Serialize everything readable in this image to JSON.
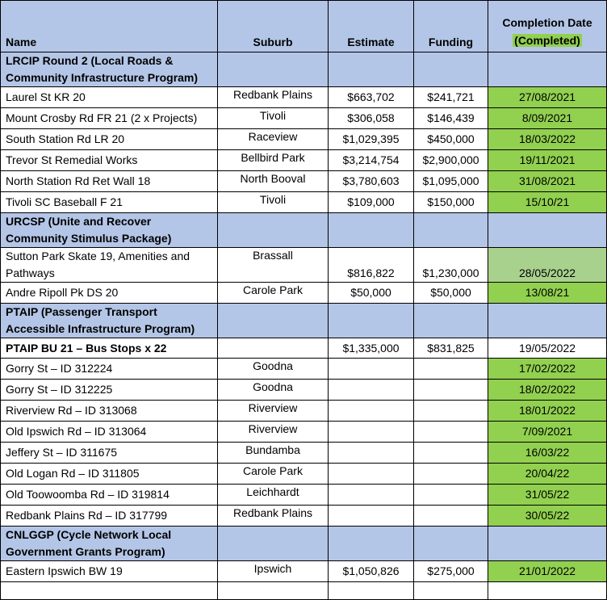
{
  "headers": {
    "name": "Name",
    "suburb": "Suburb",
    "estimate": "Estimate",
    "funding": "Funding",
    "date": "Completion Date",
    "date_sub": "(Completed)"
  },
  "sections": [
    {
      "title": "LRCIP Round 2 (Local Roads & Community Infrastructure Program)",
      "rows": [
        {
          "name": "Laurel St KR 20",
          "suburb": "Redbank Plains",
          "estimate": "$663,702",
          "funding": "$241,721",
          "date": "27/08/2021"
        },
        {
          "name": "Mount Crosby Rd FR 21 (2 x Projects)",
          "suburb": "Tivoli",
          "estimate": "$306,058",
          "funding": "$146,439",
          "date": "8/09/2021"
        },
        {
          "name": "South Station Rd LR 20",
          "suburb": "Raceview",
          "estimate": "$1,029,395",
          "funding": "$450,000",
          "date": "18/03/2022"
        },
        {
          "name": "Trevor St Remedial Works",
          "suburb": "Bellbird Park",
          "estimate": "$3,214,754",
          "funding": "$2,900,000",
          "date": "19/11/2021"
        },
        {
          "name": "North Station Rd Ret Wall 18",
          "suburb": "North Booval",
          "estimate": "$3,780,603",
          "funding": "$1,095,000",
          "date": "31/08/2021"
        },
        {
          "name": "Tivoli SC Baseball F 21",
          "suburb": "Tivoli",
          "estimate": "$109,000",
          "funding": "$150,000",
          "date": "15/10/21"
        }
      ]
    },
    {
      "title": "URCSP (Unite and Recover Community Stimulus Package)",
      "rows": [
        {
          "name": "Sutton Park Skate 19, Amenities and Pathways",
          "suburb": "Brassall",
          "estimate": "$816,822",
          "funding": "$1,230,000",
          "date": "28/05/2022"
        },
        {
          "name": "Andre Ripoll Pk DS 20",
          "suburb": "Carole Park",
          "estimate": "$50,000",
          "funding": "$50,000",
          "date": "13/08/21"
        }
      ]
    },
    {
      "title": "PTAIP (Passenger Transport Accessible Infrastructure Program)",
      "subheader": {
        "name": "PTAIP BU 21 – Bus Stops x 22",
        "estimate": "$1,335,000",
        "funding": "$831,825",
        "date": "19/05/2022"
      },
      "rows": [
        {
          "name": "Gorry St – ID 312224",
          "suburb": "Goodna",
          "date": "17/02/2022"
        },
        {
          "name": "Gorry St – ID 312225",
          "suburb": "Goodna",
          "date": "18/02/2022"
        },
        {
          "name": "Riverview Rd – ID 313068",
          "suburb": "Riverview",
          "date": "18/01/2022"
        },
        {
          "name": "Old Ipswich Rd – ID 313064",
          "suburb": "Riverview",
          "date": "7/09/2021"
        },
        {
          "name": "Jeffery St – ID 311675",
          "suburb": "Bundamba",
          "date": "16/03/22"
        },
        {
          "name": "Old Logan Rd – ID 311805",
          "suburb": "Carole Park",
          "date": "20/04/22"
        },
        {
          "name": "Old Toowoomba Rd – ID 319814",
          "suburb": "Leichhardt",
          "date": "31/05/22"
        },
        {
          "name": "Redbank Plains Rd – ID 317799",
          "suburb": "Redbank Plains",
          "date": "30/05/22"
        }
      ]
    },
    {
      "title": "CNLGGP (Cycle Network Local Government Grants Program)",
      "rows": [
        {
          "name": "Eastern Ipswich BW 19",
          "suburb": "Ipswich",
          "estimate": "$1,050,826",
          "funding": "$275,000",
          "date": "21/01/2022"
        }
      ]
    }
  ],
  "colors": {
    "header_bg": "#b4c6e7",
    "completed_green": "#92d050",
    "light_green": "#a9d18e"
  }
}
